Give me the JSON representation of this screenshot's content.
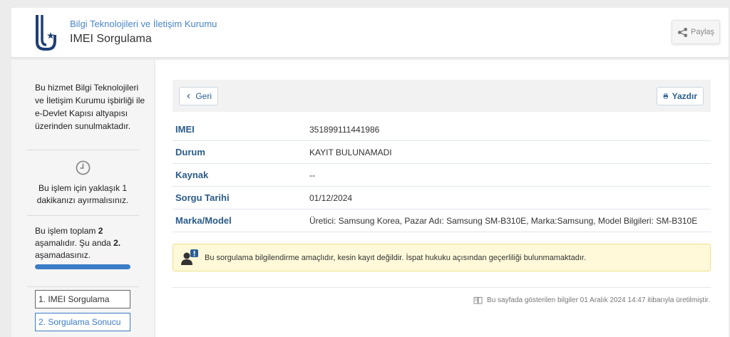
{
  "header": {
    "org_name": "Bilgi Teknolojileri ve İletişim Kurumu",
    "page_title": "IMEI Sorgulama",
    "share_label": "Paylaş"
  },
  "sidebar": {
    "intro": "Bu hizmet Bilgi Teknolojileri ve İletişim Kurumu işbirliği ile e-Devlet Kapısı altyapısı üzerinden sunulmaktadır.",
    "time_text": "Bu işlem için yaklaşık 1 dakikanızı ayırmalısınız.",
    "steps_prefix": "Bu işlem toplam ",
    "steps_total": "2",
    "steps_middle": " aşamalıdır. Şu anda ",
    "steps_current": "2.",
    "steps_suffix": " aşamadasınız.",
    "progress": 1.0,
    "steps": [
      {
        "label": "1. IMEI Sorgulama"
      },
      {
        "label": "2. Sorgulama Sonucu"
      }
    ]
  },
  "toolbar": {
    "back_label": "Geri",
    "print_label": "Yazdır"
  },
  "result": {
    "rows": [
      {
        "label": "IMEI",
        "value": "351899111441986"
      },
      {
        "label": "Durum",
        "value": "KAYIT BULUNAMADI"
      },
      {
        "label": "Kaynak",
        "value": "--"
      },
      {
        "label": "Sorgu Tarihi",
        "value": "01/12/2024"
      },
      {
        "label": "Marka/Model",
        "value": "Üretici: Samsung Korea, Pazar Adı: Samsung SM-B310E, Marka:Samsung, Model Bilgileri: SM-B310E"
      }
    ]
  },
  "alert": {
    "text": "Bu sorgulama bilgilendirme amaçlıdır, kesin kayıt değildir. İspat hukuku açısından geçerliliği bulunmamaktadır.",
    "icon": "user-warning-icon"
  },
  "footer": {
    "note": "Bu sayfada gösterilen bilgiler 01 Aralık 2024 14:47 itibarıyla üretilmiştir.",
    "icon": "book-icon"
  },
  "colors": {
    "accent": "#3c7cc6",
    "label": "#2b5b88",
    "alert_bg": "#fff9d9"
  }
}
